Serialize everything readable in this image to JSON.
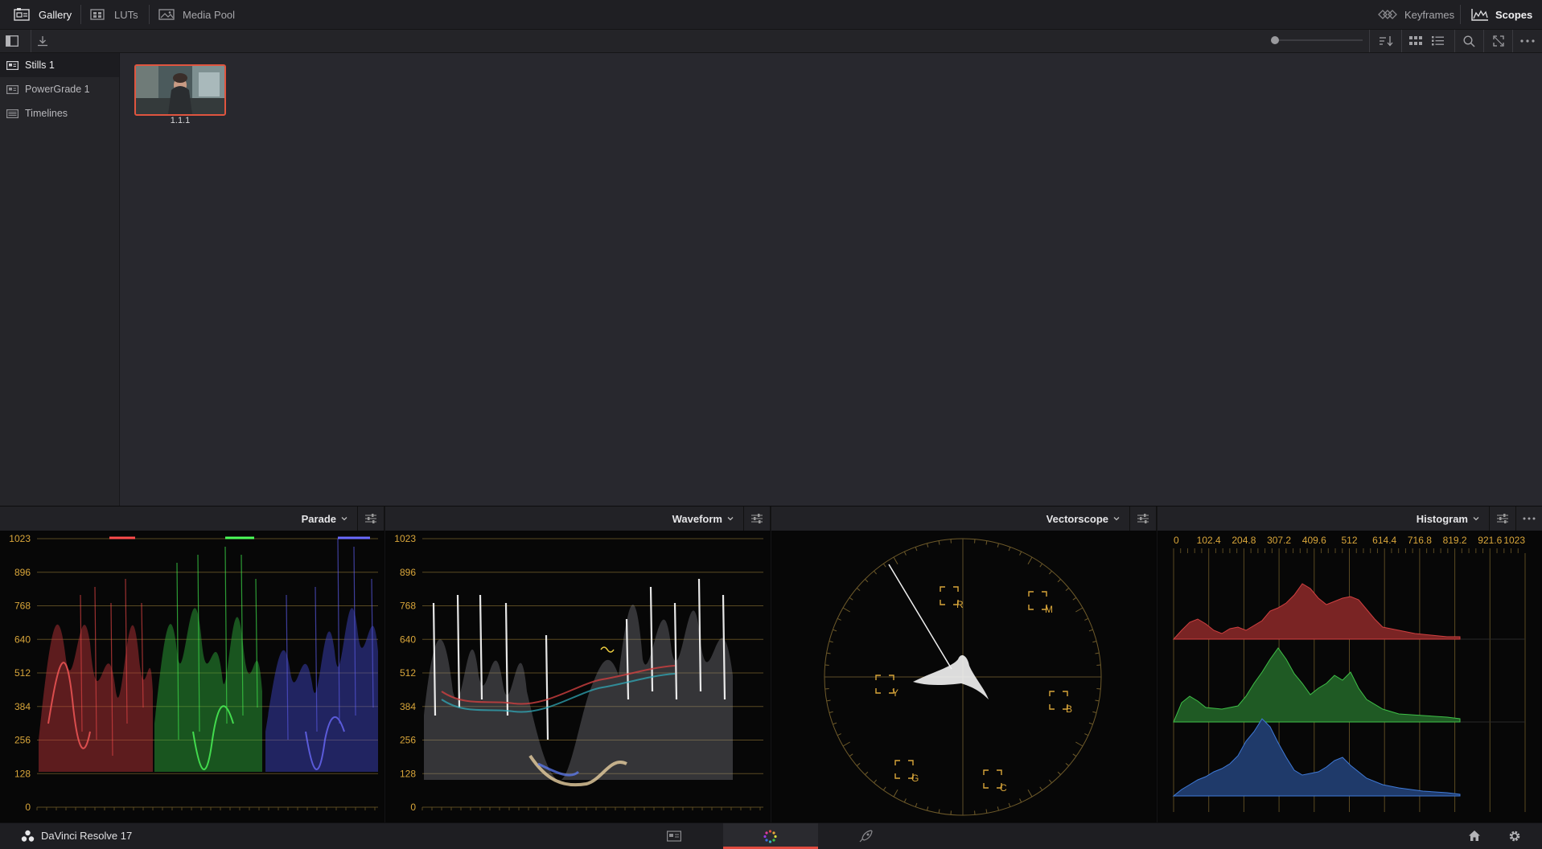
{
  "top_tabs": {
    "gallery": "Gallery",
    "luts": "LUTs",
    "media_pool": "Media Pool",
    "keyframes": "Keyframes",
    "scopes": "Scopes"
  },
  "sidebar": {
    "items": [
      {
        "label": "Stills 1",
        "icon": "still-album-icon"
      },
      {
        "label": "PowerGrade 1",
        "icon": "powergrade-album-icon"
      },
      {
        "label": "Timelines",
        "icon": "timeline-album-icon"
      }
    ]
  },
  "stills": [
    {
      "label": "1.1.1"
    }
  ],
  "scopes": {
    "panels": [
      {
        "title": "Parade"
      },
      {
        "title": "Waveform"
      },
      {
        "title": "Vectorscope"
      },
      {
        "title": "Histogram"
      }
    ],
    "waveform_scale": [
      "1023",
      "896",
      "768",
      "640",
      "512",
      "384",
      "256",
      "128",
      "0"
    ],
    "histogram_scale": [
      "0",
      "102.4",
      "204.8",
      "307.2",
      "409.6",
      "512",
      "614.4",
      "716.8",
      "819.2",
      "921.6",
      "1023"
    ],
    "vectorscope_targets": [
      "R",
      "M",
      "Y",
      "B",
      "G",
      "C"
    ],
    "accent_color": "#d9a63a"
  },
  "app": {
    "name": "DaVinci Resolve 17"
  },
  "colors": {
    "active_page_underline": "#e04a3f",
    "selected_still_border": "#e0553f"
  }
}
